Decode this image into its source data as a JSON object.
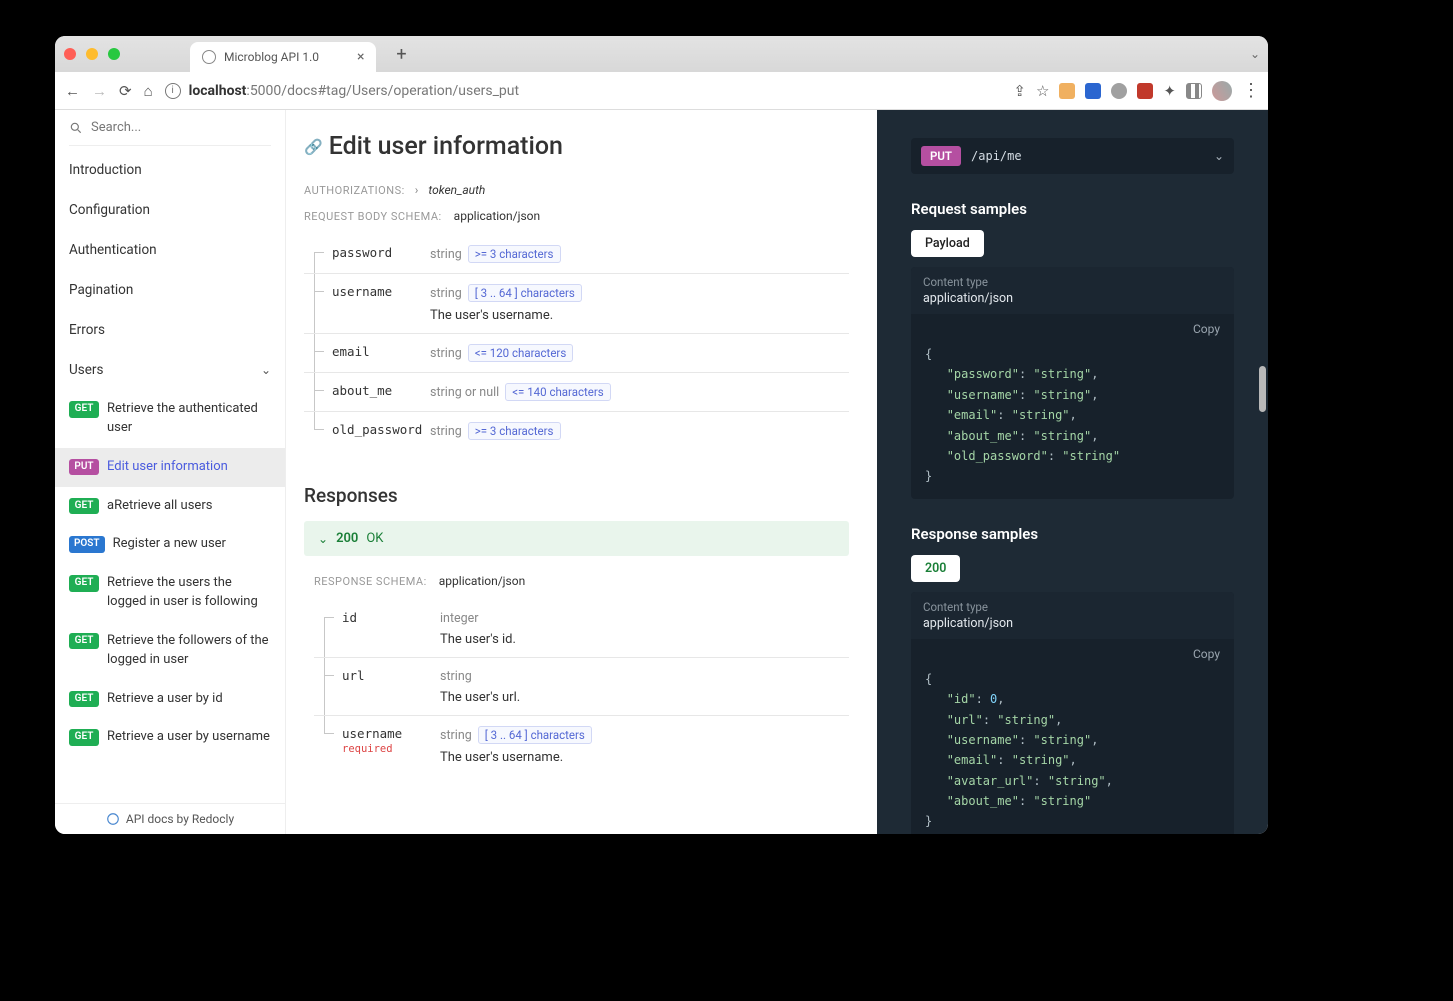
{
  "browser": {
    "tab_title": "Microblog API 1.0",
    "url_host": "localhost",
    "url_port": ":5000",
    "url_path": "/docs#tag/Users/operation/users_put"
  },
  "sidebar": {
    "search_placeholder": "Search...",
    "items": [
      {
        "label": "Introduction"
      },
      {
        "label": "Configuration"
      },
      {
        "label": "Authentication"
      },
      {
        "label": "Pagination"
      },
      {
        "label": "Errors"
      }
    ],
    "section": "Users",
    "sub": [
      {
        "method": "GET",
        "label": "Retrieve the authenticated user"
      },
      {
        "method": "PUT",
        "label": "Edit user information",
        "active": true
      },
      {
        "method": "GET",
        "label": "aRetrieve all users"
      },
      {
        "method": "POST",
        "label": "Register a new user"
      },
      {
        "method": "GET",
        "label": "Retrieve the users the logged in user is following"
      },
      {
        "method": "GET",
        "label": "Retrieve the followers of the logged in user"
      },
      {
        "method": "GET",
        "label": "Retrieve a user by id"
      },
      {
        "method": "GET",
        "label": "Retrieve a user by username"
      }
    ],
    "footer": "API docs by Redocly"
  },
  "doc": {
    "title": "Edit user information",
    "auth_label": "AUTHORIZATIONS:",
    "auth_value": "token_auth",
    "req_schema_label": "REQUEST BODY SCHEMA:",
    "req_schema_value": "application/json",
    "req_params": [
      {
        "name": "password",
        "type": "string",
        "constraint": ">= 3 characters"
      },
      {
        "name": "username",
        "type": "string",
        "constraint": "[ 3 .. 64 ] characters",
        "desc": "The user's username."
      },
      {
        "name": "email",
        "type": "string",
        "constraint": "<= 120 characters"
      },
      {
        "name": "about_me",
        "type": "string or null",
        "constraint": "<= 140 characters"
      },
      {
        "name": "old_password",
        "type": "string",
        "constraint": ">= 3 characters"
      }
    ],
    "responses_heading": "Responses",
    "status_code": "200",
    "status_text": "OK",
    "resp_schema_label": "RESPONSE SCHEMA:",
    "resp_schema_value": "application/json",
    "resp_params": [
      {
        "name": "id",
        "type": "integer",
        "desc": "The user's id."
      },
      {
        "name": "url",
        "type": "string",
        "desc": "The user's url."
      },
      {
        "name": "username",
        "type": "string",
        "constraint": "[ 3 .. 64 ] characters",
        "desc": "The user's username.",
        "required": "required"
      }
    ]
  },
  "dark": {
    "method": "PUT",
    "path": "/api/me",
    "req_heading": "Request samples",
    "payload_tab": "Payload",
    "ct_label": "Content type",
    "ct_value": "application/json",
    "copy": "Copy",
    "resp_heading": "Response samples",
    "resp_tab": "200",
    "req_sample": {
      "password": "string",
      "username": "string",
      "email": "string",
      "about_me": "string",
      "old_password": "string"
    },
    "resp_sample": {
      "id": 0,
      "url": "string",
      "username": "string",
      "email": "string",
      "avatar_url": "string",
      "about_me": "string"
    }
  }
}
